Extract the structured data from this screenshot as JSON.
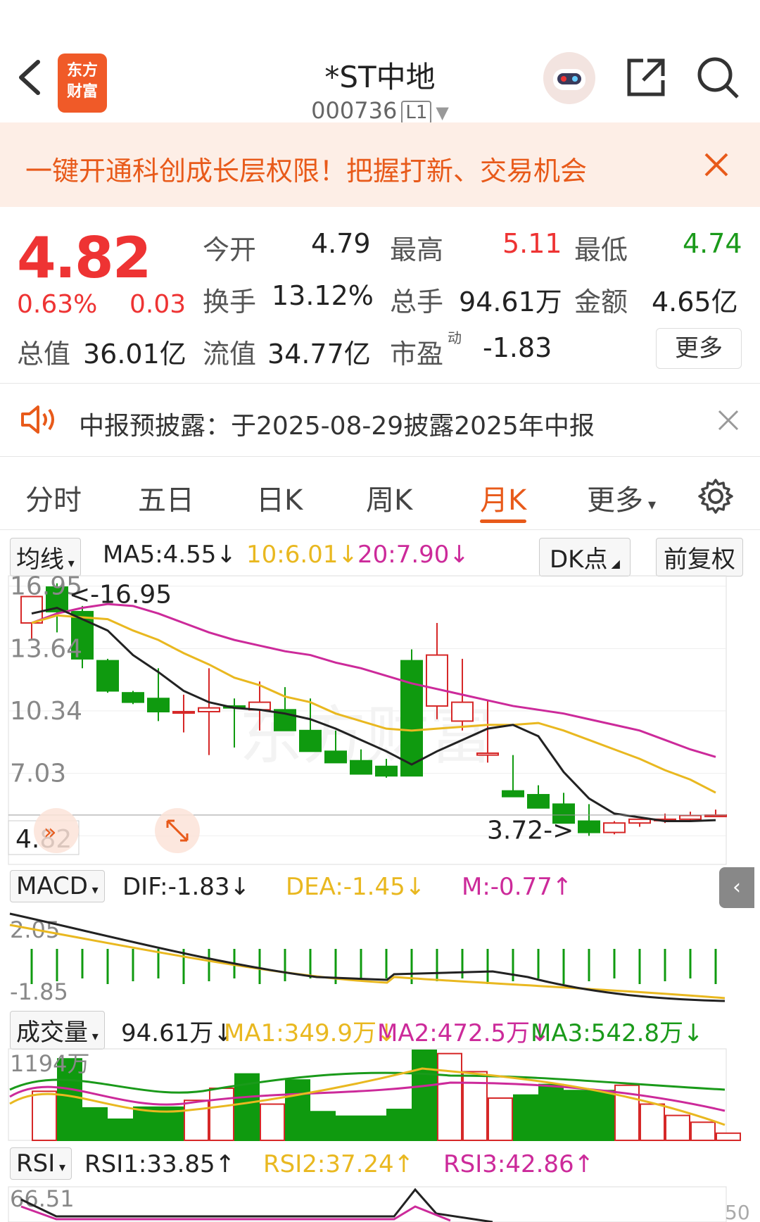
{
  "header": {
    "title": "*ST中地",
    "code": "000736",
    "level": "L1",
    "logo_line1": "东方",
    "logo_line2": "财富"
  },
  "banner": {
    "text": "一键开通科创成长层权限！把握打新、交易机会"
  },
  "quote": {
    "price": "4.82",
    "change_pct": "0.63%",
    "change": "0.03",
    "open_label": "今开",
    "open": "4.79",
    "high_label": "最高",
    "high": "5.11",
    "low_label": "最低",
    "low": "4.74",
    "turnover_label": "换手",
    "turnover": "13.12%",
    "volume_label": "总手",
    "volume": "94.61万",
    "amount_label": "金额",
    "amount": "4.65亿",
    "mcap_label": "总值",
    "mcap": "36.01亿",
    "float_label": "流值",
    "float": "34.77亿",
    "pe_label": "市盈",
    "pe_sup": "动",
    "pe": "-1.83",
    "more": "更多"
  },
  "notice": {
    "text": "中报预披露：于2025-08-29披露2025年中报"
  },
  "tabs": [
    "分时",
    "五日",
    "日K",
    "周K",
    "月K",
    "更多"
  ],
  "active_tab": "月K",
  "ma_bar": {
    "select": "均线",
    "ma5": "MA5:4.55",
    "ma10": "10:6.01",
    "ma20": "20:7.90",
    "dk": "DK点",
    "adjust": "前复权"
  },
  "kline": {
    "y_labels": [
      "16.95",
      "13.64",
      "10.34",
      "7.03",
      "3.72"
    ],
    "max_note": "<-16.95",
    "min_note": "3.72->",
    "last_price": "4.82"
  },
  "macd_bar": {
    "select": "MACD",
    "dif": "DIF:-1.83",
    "dea": "DEA:-1.45",
    "m": "M:-0.77"
  },
  "macd": {
    "top": "2.05",
    "bottom": "-1.85"
  },
  "vol_bar": {
    "select": "成交量",
    "vol": "94.61万",
    "ma1": "MA1:349.9万",
    "ma2": "MA2:472.5万",
    "ma3": "MA3:542.8万"
  },
  "vol": {
    "top": "1194万"
  },
  "rsi_bar": {
    "select": "RSI",
    "rsi1": "RSI1:33.85",
    "rsi2": "RSI2:37.24",
    "rsi3": "RSI3:42.86"
  },
  "rsi": {
    "top": "66.51",
    "right": "50"
  },
  "chart_data": {
    "type": "candlestick",
    "open": [
      15.0,
      16.9,
      15.6,
      13.0,
      11.3,
      11.0,
      10.3,
      10.3,
      10.6,
      10.4,
      10.4,
      9.3,
      8.2,
      7.7,
      7.4,
      13.0,
      10.6,
      9.8,
      8.0,
      6.1,
      5.9,
      5.4,
      4.5,
      3.9,
      4.4,
      4.6,
      4.6,
      4.79
    ],
    "high": [
      16.0,
      17.1,
      15.9,
      13.1,
      11.4,
      12.6,
      11.2,
      12.6,
      11.0,
      11.9,
      11.6,
      11.0,
      9.3,
      8.3,
      7.8,
      13.6,
      15.0,
      13.1,
      10.9,
      8.0,
      6.4,
      6.0,
      5.4,
      4.5,
      4.6,
      4.9,
      5.0,
      5.11
    ],
    "low": [
      14.1,
      14.5,
      12.6,
      11.3,
      10.7,
      9.8,
      9.2,
      8.0,
      8.4,
      9.3,
      9.6,
      8.7,
      7.7,
      7.1,
      6.8,
      7.0,
      9.9,
      9.3,
      7.6,
      5.9,
      5.4,
      4.5,
      3.72,
      3.8,
      4.2,
      4.4,
      4.5,
      4.74
    ],
    "close": [
      16.4,
      15.6,
      13.1,
      11.4,
      10.8,
      10.3,
      10.3,
      10.5,
      10.5,
      10.8,
      9.3,
      8.2,
      7.6,
      7.0,
      6.9,
      6.9,
      13.3,
      10.8,
      8.1,
      5.8,
      5.2,
      4.4,
      3.9,
      4.4,
      4.6,
      4.6,
      4.8,
      4.82
    ],
    "ma5": [
      15.5,
      15.8,
      15.2,
      14.6,
      13.3,
      12.4,
      11.4,
      10.8,
      10.5,
      10.4,
      10.2,
      9.9,
      9.4,
      8.8,
      8.2,
      7.5,
      8.2,
      8.8,
      9.4,
      9.6,
      9.0,
      7.1,
      5.7,
      4.9,
      4.7,
      4.5,
      4.5,
      4.55
    ],
    "ma10": [
      15.0,
      15.4,
      15.3,
      15.2,
      14.6,
      14.1,
      13.4,
      12.8,
      12.1,
      11.7,
      11.1,
      10.8,
      10.2,
      9.8,
      9.4,
      9.3,
      9.4,
      9.5,
      9.6,
      9.6,
      9.7,
      9.3,
      8.8,
      8.3,
      7.8,
      7.2,
      6.7,
      6.01
    ],
    "ma20": [
      15.0,
      15.5,
      15.8,
      16.0,
      15.9,
      15.5,
      15.0,
      14.5,
      14.1,
      13.8,
      13.5,
      13.3,
      12.9,
      12.6,
      12.2,
      11.8,
      11.5,
      11.2,
      10.9,
      10.6,
      10.4,
      10.2,
      9.9,
      9.6,
      9.3,
      8.8,
      8.3,
      7.9
    ],
    "ylim": [
      3.4,
      17.2
    ],
    "y_ticks": [
      16.95,
      13.64,
      10.34,
      7.03,
      3.72
    ],
    "volume": [
      650,
      1080,
      430,
      280,
      440,
      440,
      530,
      690,
      880,
      480,
      800,
      380,
      320,
      320,
      410,
      1194,
      1150,
      910,
      560,
      600,
      740,
      660,
      660,
      730,
      480,
      330,
      240,
      95
    ],
    "vol_ylim": [
      0,
      1194
    ]
  }
}
